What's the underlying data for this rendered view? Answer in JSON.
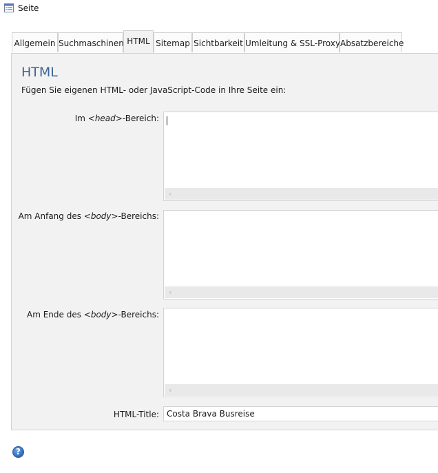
{
  "window": {
    "title": "Seite",
    "icon": "page-settings-icon"
  },
  "tabs": [
    {
      "label": "Allgemein"
    },
    {
      "label": "Suchmaschinen"
    },
    {
      "label": "HTML"
    },
    {
      "label": "Sitemap"
    },
    {
      "label": "Sichtbarkeit"
    },
    {
      "label": "Umleitung & SSL-Proxy"
    },
    {
      "label": "Absatzbereiche"
    }
  ],
  "active_tab": "HTML",
  "section": {
    "title": "HTML",
    "description": "Fügen Sie eigenen HTML- oder JavaScript-Code in Ihre Seite ein:"
  },
  "fields": {
    "head": {
      "prefix": "Im <",
      "tag": "head",
      "suffix": ">-Bereich:",
      "value": ""
    },
    "body_start": {
      "prefix": "Am Anfang des <",
      "tag": "body",
      "suffix": ">-Bereichs:",
      "value": ""
    },
    "body_end": {
      "prefix": "Am Ende des <",
      "tag": "body",
      "suffix": ">-Bereichs:",
      "value": ""
    },
    "html_title": {
      "label": "HTML-Title:",
      "value": "Costa Brava Busreise"
    }
  },
  "icons": {
    "scroll_left": "‹",
    "help": "?"
  },
  "colors": {
    "accent": "#3f6592",
    "panel": "#f2f2f2",
    "border": "#d3d3d3"
  }
}
